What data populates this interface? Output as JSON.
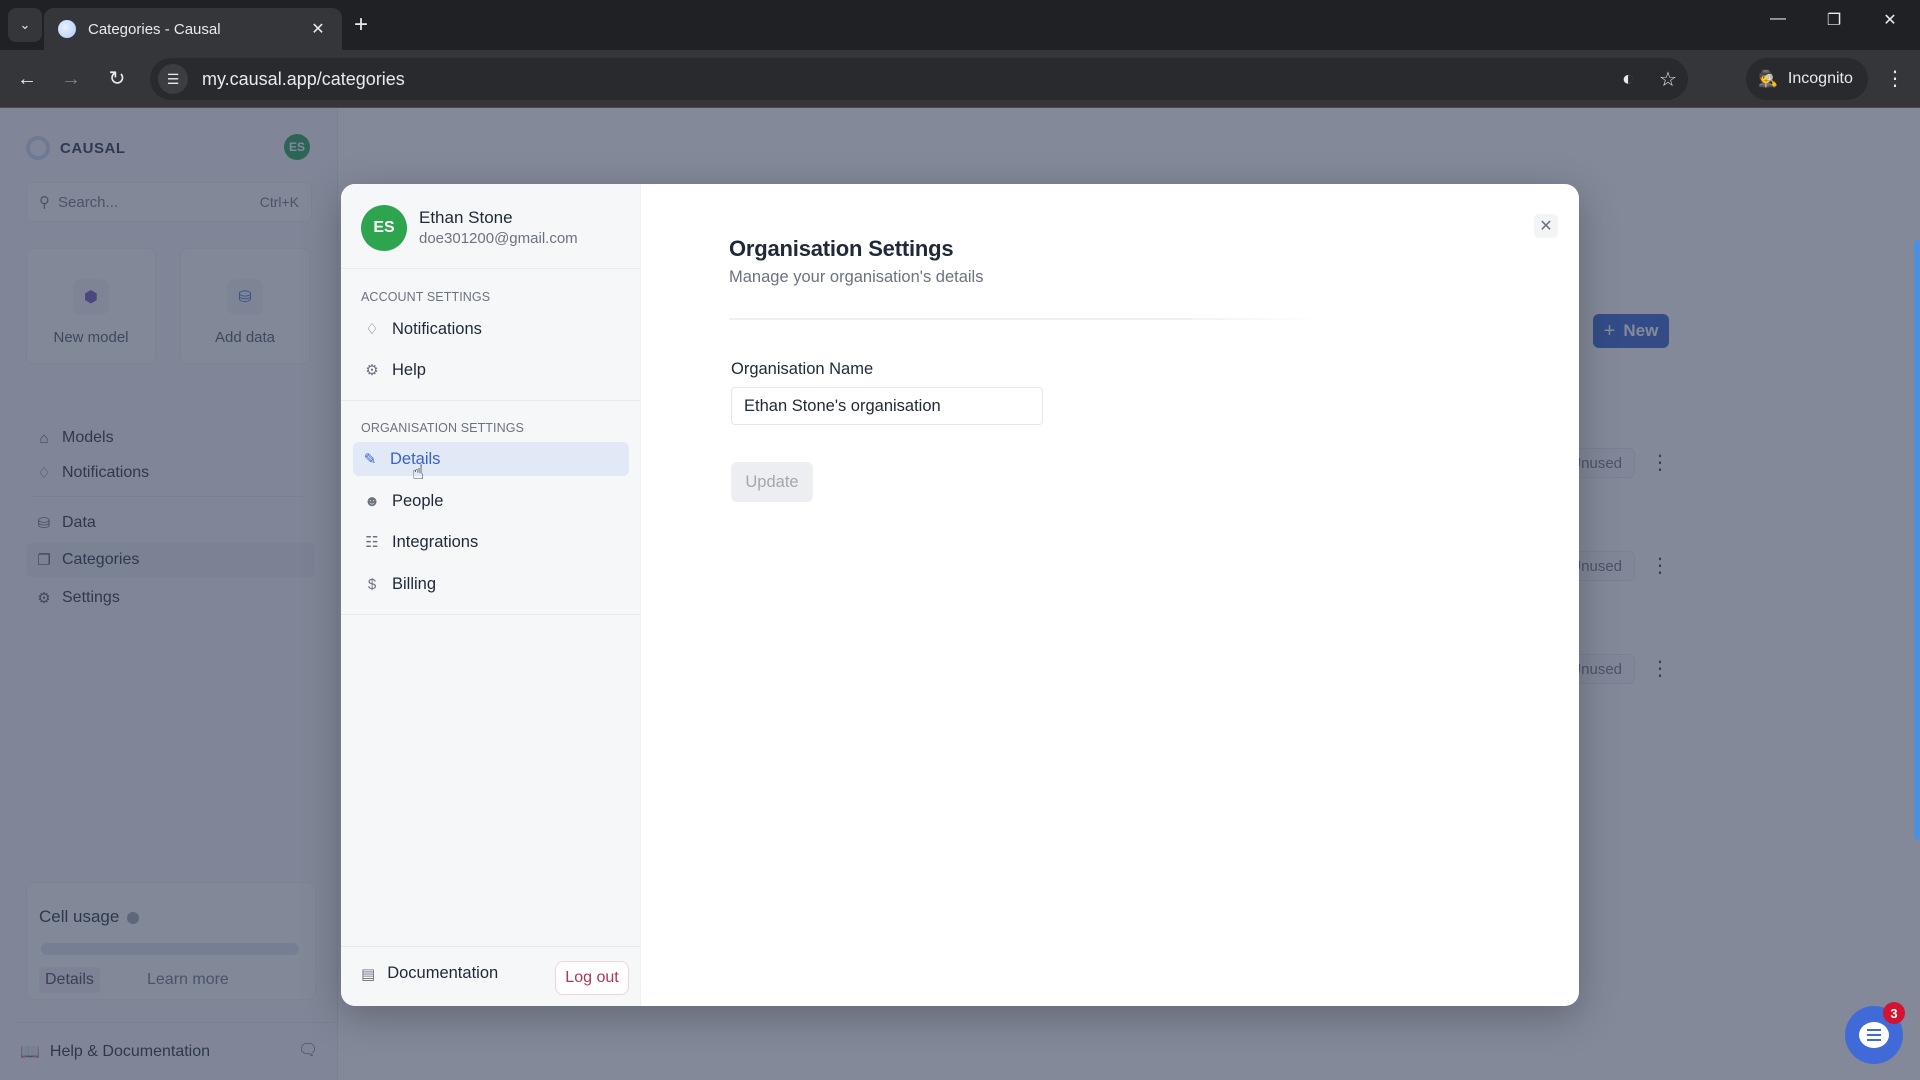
{
  "browser": {
    "tab_title": "Categories - Causal",
    "url": "my.causal.app/categories",
    "incognito_label": "Incognito"
  },
  "sidebar": {
    "brand": "CAUSAL",
    "avatar_initials": "ES",
    "search_placeholder": "Search...",
    "search_shortcut": "Ctrl+K",
    "quick_actions": [
      {
        "label": "New model",
        "icon": "cube-icon"
      },
      {
        "label": "Add data",
        "icon": "database-icon"
      }
    ],
    "nav": [
      {
        "label": "Models",
        "icon": "home-icon"
      },
      {
        "label": "Notifications",
        "icon": "bell-icon"
      },
      {
        "label": "Data",
        "icon": "database-icon"
      },
      {
        "label": "Categories",
        "icon": "categories-icon",
        "active": true
      },
      {
        "label": "Settings",
        "icon": "gear-icon"
      }
    ],
    "cell_usage": {
      "title": "Cell usage",
      "fill_fraction": 0.0,
      "details_label": "Details",
      "learn_more_label": "Learn more"
    },
    "help_label": "Help & Documentation"
  },
  "main": {
    "new_button": "New",
    "rows": [
      {
        "status": "Unused"
      },
      {
        "status": "Unused"
      },
      {
        "status": "Unused"
      }
    ]
  },
  "modal": {
    "user": {
      "initials": "ES",
      "name": "Ethan Stone",
      "email": "doe301200@gmail.com"
    },
    "account_section": "ACCOUNT SETTINGS",
    "account_items": [
      {
        "label": "Notifications",
        "icon": "bell-icon"
      },
      {
        "label": "Help",
        "icon": "help-icon"
      }
    ],
    "org_section": "ORGANISATION SETTINGS",
    "org_items": [
      {
        "label": "Details",
        "icon": "pencil-icon",
        "active": true
      },
      {
        "label": "People",
        "icon": "people-icon"
      },
      {
        "label": "Integrations",
        "icon": "integrations-icon"
      },
      {
        "label": "Billing",
        "icon": "dollar-icon"
      }
    ],
    "documentation_label": "Documentation",
    "logout_label": "Log out",
    "title": "Organisation Settings",
    "subtitle": "Manage your organisation's details",
    "field_label": "Organisation Name",
    "field_value": "Ethan Stone's organisation",
    "update_label": "Update"
  },
  "chat_widget": {
    "badge_count": "3"
  }
}
